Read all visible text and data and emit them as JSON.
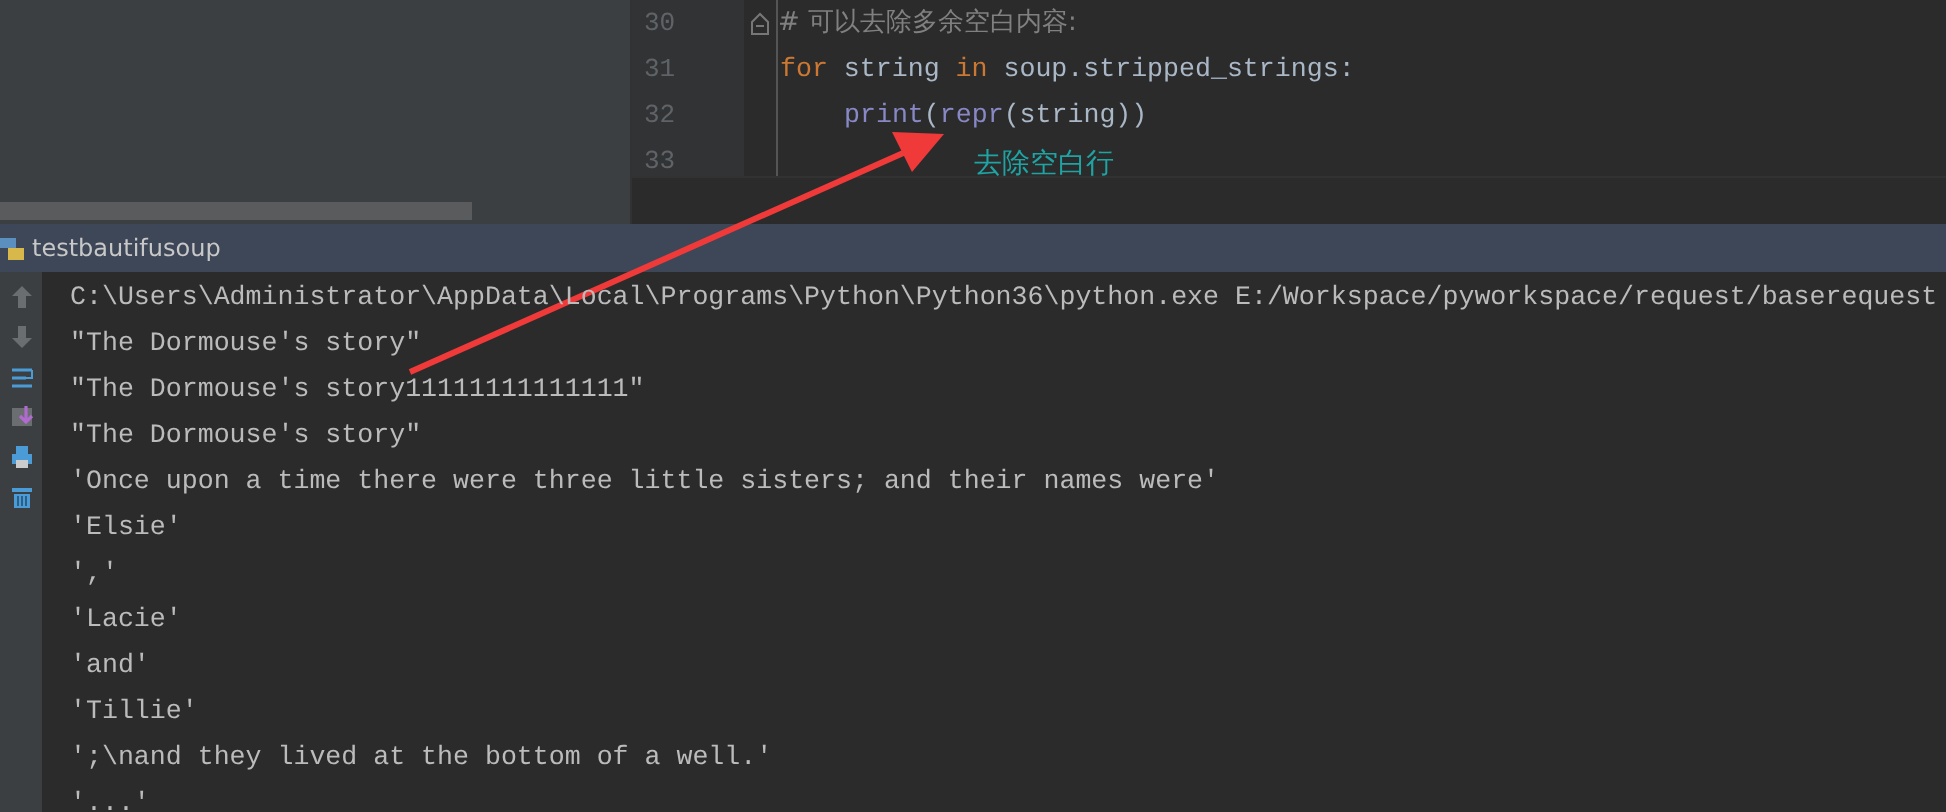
{
  "editor": {
    "lines": [
      {
        "number": "30",
        "fold": true,
        "tokens": [
          {
            "kind": "comment",
            "text": "# 可以去除多余空白内容:"
          }
        ]
      },
      {
        "number": "31",
        "tokens": [
          {
            "kind": "keyword",
            "text": "for"
          },
          {
            "kind": "plain",
            "text": " string "
          },
          {
            "kind": "keyword",
            "text": "in"
          },
          {
            "kind": "plain",
            "text": " soup.stripped_strings:"
          }
        ]
      },
      {
        "number": "32",
        "indent": true,
        "tokens": [
          {
            "kind": "builtin",
            "text": "print"
          },
          {
            "kind": "plain",
            "text": "("
          },
          {
            "kind": "builtin",
            "text": "repr"
          },
          {
            "kind": "plain",
            "text": "(string))"
          }
        ]
      },
      {
        "number": "33"
      }
    ]
  },
  "annotation": {
    "text": "去除空白行"
  },
  "run_panel": {
    "title": "testbautifusoup",
    "toolbar": [
      {
        "kind": "up"
      },
      {
        "kind": "down"
      },
      {
        "kind": "wrap"
      },
      {
        "kind": "scroll"
      },
      {
        "kind": "print"
      },
      {
        "kind": "trash"
      }
    ],
    "output": [
      "C:\\Users\\Administrator\\AppData\\Local\\Programs\\Python\\Python36\\python.exe E:/Workspace/pyworkspace/request/baserequest",
      "\"The Dormouse's story\"",
      "\"The Dormouse's story11111111111111\"",
      "\"The Dormouse's story\"",
      "'Once upon a time there were three little sisters; and their names were'",
      "'Elsie'",
      "','",
      "'Lacie'",
      "'and'",
      "'Tillie'",
      "';\\nand they lived at the bottom of a well.'",
      "'...'"
    ]
  }
}
